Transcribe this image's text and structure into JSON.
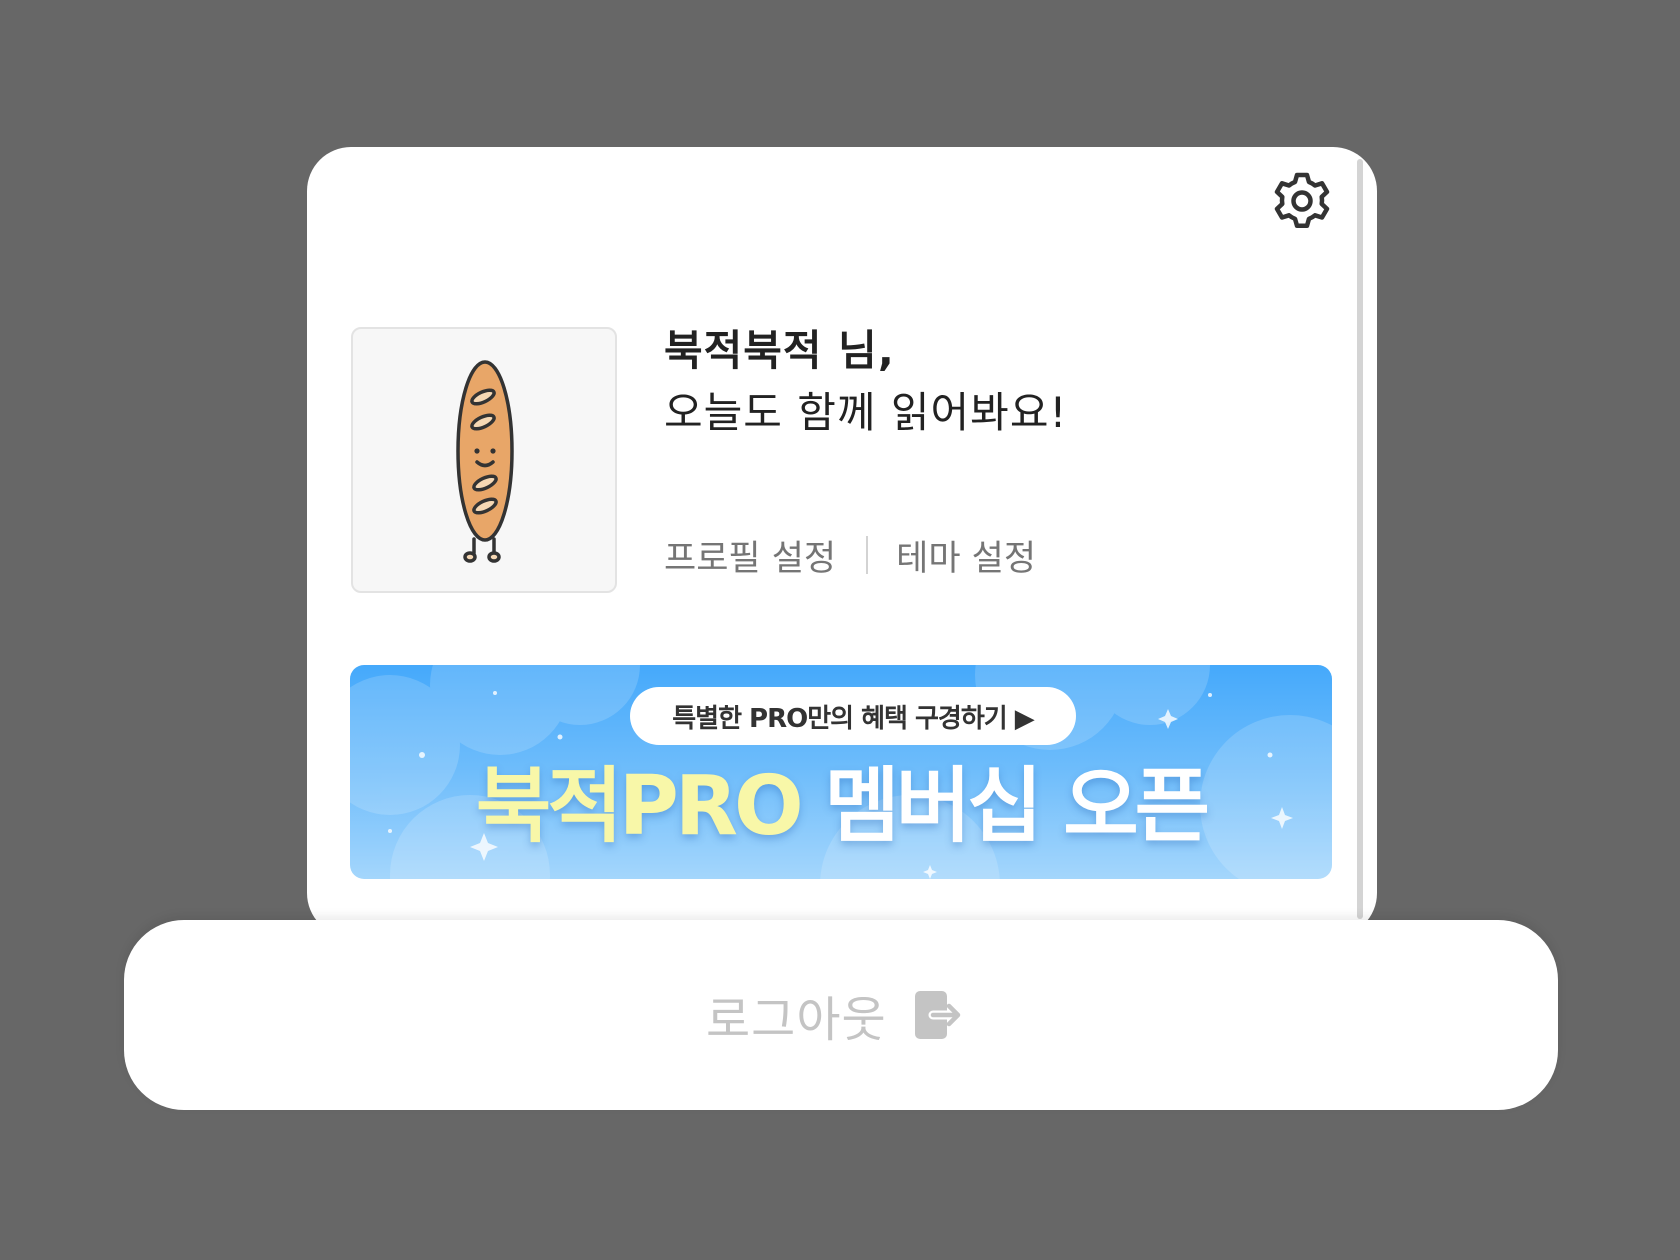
{
  "profile": {
    "name_line": "북적북적 님,",
    "greeting_line": "오늘도 함께 읽어봐요!",
    "profile_settings_label": "프로필 설정",
    "theme_settings_label": "테마 설정",
    "avatar_icon": "baguette-character-icon"
  },
  "settings": {
    "icon": "gear-icon"
  },
  "banner": {
    "pill_label": "특별한 PRO만의 혜택 구경하기 ▶",
    "title_part1": "북적PRO",
    "title_part2": "멤버십 오픈"
  },
  "footer": {
    "logout_label": "로그아웃",
    "logout_icon": "logout-icon"
  },
  "colors": {
    "background": "#676767",
    "banner_top": "#45a9fb",
    "banner_bottom": "#a4d6fc",
    "banner_accent": "#f8f7a8",
    "bread": "#e8a668"
  }
}
